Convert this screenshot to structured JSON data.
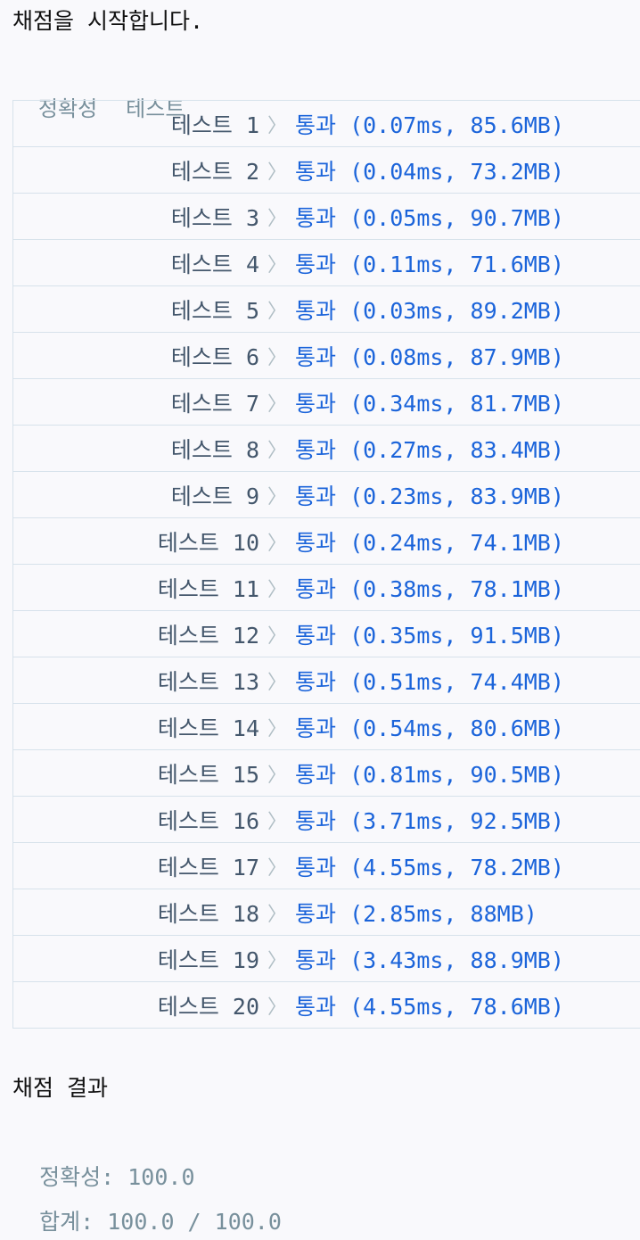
{
  "header": {
    "status": "채점을 시작합니다."
  },
  "section": {
    "accuracy": "정확성",
    "tests": "테스트"
  },
  "tests": [
    {
      "label": "테스트 1",
      "result": "통과",
      "detail": "(0.07ms, 85.6MB)"
    },
    {
      "label": "테스트 2",
      "result": "통과",
      "detail": "(0.04ms, 73.2MB)"
    },
    {
      "label": "테스트 3",
      "result": "통과",
      "detail": "(0.05ms, 90.7MB)"
    },
    {
      "label": "테스트 4",
      "result": "통과",
      "detail": "(0.11ms, 71.6MB)"
    },
    {
      "label": "테스트 5",
      "result": "통과",
      "detail": "(0.03ms, 89.2MB)"
    },
    {
      "label": "테스트 6",
      "result": "통과",
      "detail": "(0.08ms, 87.9MB)"
    },
    {
      "label": "테스트 7",
      "result": "통과",
      "detail": "(0.34ms, 81.7MB)"
    },
    {
      "label": "테스트 8",
      "result": "통과",
      "detail": "(0.27ms, 83.4MB)"
    },
    {
      "label": "테스트 9",
      "result": "통과",
      "detail": "(0.23ms, 83.9MB)"
    },
    {
      "label": "테스트 10",
      "result": "통과",
      "detail": "(0.24ms, 74.1MB)"
    },
    {
      "label": "테스트 11",
      "result": "통과",
      "detail": "(0.38ms, 78.1MB)"
    },
    {
      "label": "테스트 12",
      "result": "통과",
      "detail": "(0.35ms, 91.5MB)"
    },
    {
      "label": "테스트 13",
      "result": "통과",
      "detail": "(0.51ms, 74.4MB)"
    },
    {
      "label": "테스트 14",
      "result": "통과",
      "detail": "(0.54ms, 80.6MB)"
    },
    {
      "label": "테스트 15",
      "result": "통과",
      "detail": "(0.81ms, 90.5MB)"
    },
    {
      "label": "테스트 16",
      "result": "통과",
      "detail": "(3.71ms, 92.5MB)"
    },
    {
      "label": "테스트 17",
      "result": "통과",
      "detail": "(4.55ms, 78.2MB)"
    },
    {
      "label": "테스트 18",
      "result": "통과",
      "detail": "(2.85ms, 88MB)"
    },
    {
      "label": "테스트 19",
      "result": "통과",
      "detail": "(3.43ms, 88.9MB)"
    },
    {
      "label": "테스트 20",
      "result": "통과",
      "detail": "(4.55ms, 78.6MB)"
    }
  ],
  "summary": {
    "title": "채점 결과",
    "accuracy_label": "정확성:",
    "accuracy_value": "100.0",
    "total_label": "합계:",
    "total_value": "100.0 / 100.0"
  },
  "colors": {
    "pass": "#1b64da",
    "muted": "#78909c",
    "border": "#d7e2eb"
  },
  "icons": {
    "row_separator": "chevron-right-icon"
  }
}
